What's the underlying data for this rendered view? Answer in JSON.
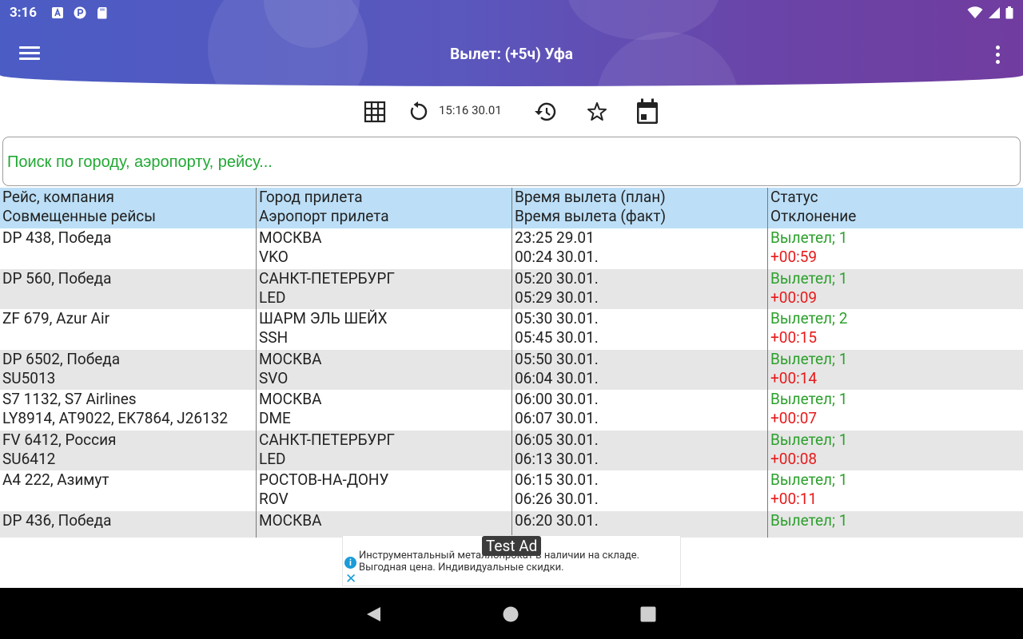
{
  "status_bar": {
    "time": "3:16"
  },
  "toolbar": {
    "title": "Вылет: (+5ч) Уфа"
  },
  "actions": {
    "updated_at": "15:16 30.01"
  },
  "search": {
    "placeholder": "Поиск по городу, аэропорту, рейсу..."
  },
  "table": {
    "headers": [
      {
        "line1": "Рейс, компания",
        "line2": "Совмещенные рейсы"
      },
      {
        "line1": "Город прилета",
        "line2": "Аэропорт прилета"
      },
      {
        "line1": "Время вылета (план)",
        "line2": "Время вылета (факт)"
      },
      {
        "line1": "Статус",
        "line2": "Отклонение"
      }
    ],
    "rows": [
      {
        "flight": "DP 438, Победа",
        "codeshare": "",
        "city": "МОСКВА",
        "airport": "VKO",
        "planned": "23:25 29.01",
        "actual": "00:24 30.01.",
        "status": "Вылетел;  1",
        "delay": "+00:59"
      },
      {
        "flight": "DP 560, Победа",
        "codeshare": "",
        "city": "САНКТ-ПЕТЕРБУРГ",
        "airport": "LED",
        "planned": "05:20 30.01.",
        "actual": "05:29 30.01.",
        "status": "Вылетел;  1",
        "delay": "+00:09"
      },
      {
        "flight": "ZF 679, Azur Air",
        "codeshare": "",
        "city": "ШАРМ ЭЛЬ ШЕЙХ",
        "airport": "SSH",
        "planned": "05:30 30.01.",
        "actual": "05:45 30.01.",
        "status": "Вылетел;  2",
        "delay": "+00:15"
      },
      {
        "flight": "DP 6502, Победа",
        "codeshare": "SU5013",
        "city": "МОСКВА",
        "airport": "SVO",
        "planned": "05:50 30.01.",
        "actual": "06:04 30.01.",
        "status": "Вылетел;  1",
        "delay": "+00:14"
      },
      {
        "flight": "S7 1132, S7 Airlines",
        "codeshare": "LY8914, AT9022, EK7864, J26132",
        "city": "МОСКВА",
        "airport": "DME",
        "planned": "06:00 30.01.",
        "actual": "06:07 30.01.",
        "status": "Вылетел;  1",
        "delay": "+00:07"
      },
      {
        "flight": "FV 6412, Россия",
        "codeshare": "SU6412",
        "city": "САНКТ-ПЕТЕРБУРГ",
        "airport": "LED",
        "planned": "06:05 30.01.",
        "actual": "06:13 30.01.",
        "status": "Вылетел;  1",
        "delay": "+00:08"
      },
      {
        "flight": "A4 222, Азимут",
        "codeshare": "",
        "city": "РОСТОВ-НА-ДОНУ",
        "airport": "ROV",
        "planned": "06:15 30.01.",
        "actual": "06:26 30.01.",
        "status": "Вылетел;  1",
        "delay": "+00:11"
      },
      {
        "flight": "DP 436, Победа",
        "codeshare": "",
        "city": "МОСКВА",
        "airport": "",
        "planned": "06:20 30.01.",
        "actual": "",
        "status": "Вылетел;  1",
        "delay": ""
      }
    ]
  },
  "ad": {
    "label": "Test Ad",
    "line1": "Инструментальный металлопрокат в наличии на складе.",
    "line2": "Выгодная цена. Индивидуальные скидки.",
    "info_glyph": "i",
    "close_glyph": "✕"
  },
  "colors": {
    "status_ok": "#2ca02c",
    "delay": "#e8191a",
    "header_row": "#bcdff7",
    "accent": "#5a57bd"
  }
}
